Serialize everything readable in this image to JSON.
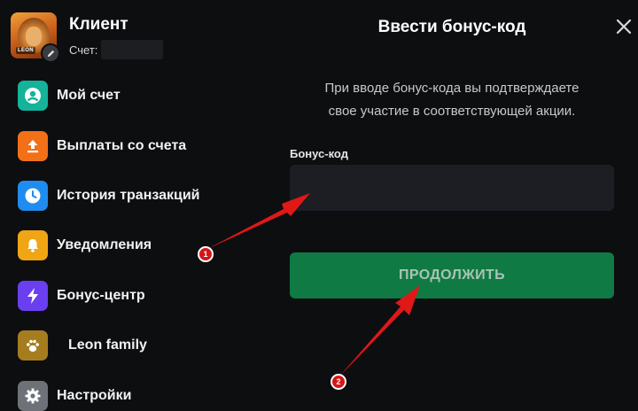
{
  "profile": {
    "name": "Клиент",
    "account_label": "Счет:",
    "avatar_tag": "LEON"
  },
  "menu": [
    {
      "label": "Мой счет",
      "icon": "user-circle-icon",
      "color": "#14b39a"
    },
    {
      "label": "Выплаты со счета",
      "icon": "upload-icon",
      "color": "#f27018"
    },
    {
      "label": "История транзакций",
      "icon": "clock-icon",
      "color": "#1f8cf0"
    },
    {
      "label": "Уведомления",
      "icon": "bell-icon",
      "color": "#f0a514"
    },
    {
      "label": "Бонус-центр",
      "icon": "lightning-icon",
      "color": "#6a3ff0"
    },
    {
      "label": "Leon family",
      "icon": "paw-icon",
      "color": "#a57d1e"
    },
    {
      "label": "Настройки",
      "icon": "gear-icon",
      "color": "#6e7178"
    }
  ],
  "dialog": {
    "title": "Ввести бонус-код",
    "info_line1": "При вводе бонус-кода вы подтверждаете",
    "info_line2": "свое участие в соответствующей акции.",
    "field_label": "Бонус-код",
    "field_value": "",
    "button_label": "ПРОДОЛЖИТЬ"
  },
  "annotations": {
    "marker1": "1",
    "marker2": "2",
    "color": "#d61616"
  }
}
